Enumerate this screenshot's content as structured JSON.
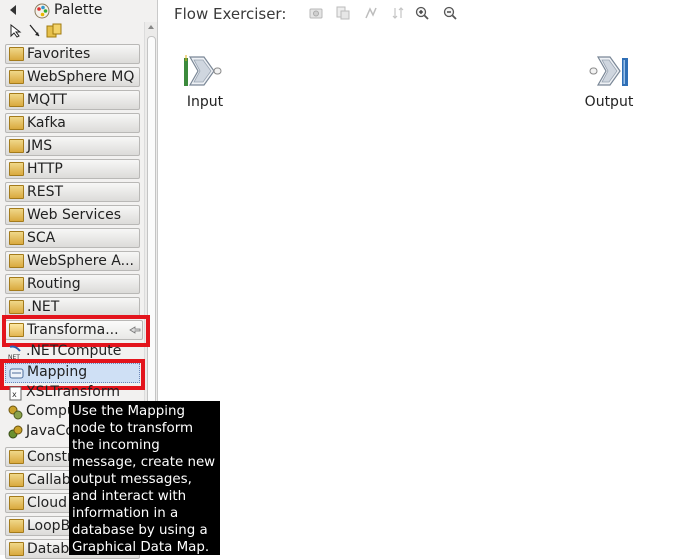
{
  "palette": {
    "title": "Palette",
    "drawers": [
      {
        "label": "Favorites",
        "icon": "favorites-folder-icon"
      },
      {
        "label": "WebSphere MQ",
        "icon": "mq-folder-icon"
      },
      {
        "label": "MQTT",
        "icon": "mqtt-folder-icon"
      },
      {
        "label": "Kafka",
        "icon": "kafka-folder-icon"
      },
      {
        "label": "JMS",
        "icon": "jms-folder-icon"
      },
      {
        "label": "HTTP",
        "icon": "http-folder-icon"
      },
      {
        "label": "REST",
        "icon": "rest-folder-icon"
      },
      {
        "label": "Web Services",
        "icon": "web-services-folder-icon"
      },
      {
        "label": "SCA",
        "icon": "sca-folder-icon"
      },
      {
        "label": "WebSphere A...",
        "icon": "websphere-adapters-folder-icon"
      },
      {
        "label": "Routing",
        "icon": "routing-folder-icon"
      },
      {
        "label": ".NET",
        "icon": "dotnet-folder-icon"
      },
      {
        "label": "Transforma...",
        "icon": "transformation-folder-icon"
      }
    ],
    "items": [
      {
        "label": ".NETCompute",
        "icon": "dotnet-compute-node-icon"
      },
      {
        "label": "Mapping",
        "icon": "mapping-node-icon"
      },
      {
        "label": "XSLTransform",
        "icon": "xsl-transform-node-icon"
      },
      {
        "label": "Compute",
        "icon": "compute-node-icon"
      },
      {
        "label": "JavaCompute",
        "icon": "java-compute-node-icon"
      }
    ],
    "lower_drawers": [
      {
        "label": "Construction",
        "icon": "construction-folder-icon"
      },
      {
        "label": "Callable",
        "icon": "callable-folder-icon"
      },
      {
        "label": "Cloud",
        "icon": "cloud-folder-icon"
      },
      {
        "label": "LoopBack",
        "icon": "loopback-folder-icon"
      },
      {
        "label": "Database",
        "icon": "database-folder-icon"
      }
    ]
  },
  "canvas": {
    "title": "Flow Exerciser:",
    "nodes": [
      {
        "label": "Input"
      },
      {
        "label": "Output"
      }
    ]
  },
  "tooltip": {
    "lines": [
      "Use the Mapping",
      "node to transform",
      "the incoming",
      "message, create new",
      "output messages,",
      "and interact with",
      "information in a",
      "database by using a",
      "Graphical Data Map."
    ]
  },
  "colors": {
    "highlight": "#e3141c",
    "selection": "#cfe0f5"
  }
}
